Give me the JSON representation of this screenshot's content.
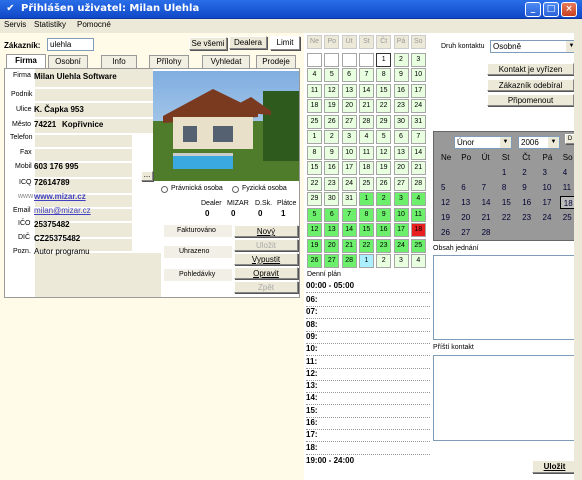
{
  "window": {
    "title": "Přihlášen uživatel: Milan Ulehla",
    "icon": "checkmark-icon"
  },
  "menu": {
    "items": [
      "Servis",
      "Statistiky",
      "Pomocné"
    ]
  },
  "customer": {
    "label": "Zákazník:",
    "value": "ulehla",
    "all_button": "Se všemi",
    "dealer_tab": "Dealera",
    "limit_tab": "Limit"
  },
  "tabs": [
    "Firma",
    "Osobní",
    "Info",
    "Přílohy",
    "Vyhledat",
    "Prodeje"
  ],
  "firm": {
    "firma_label": "Firma",
    "firma": "Milan Ulehla Software",
    "podnik_label": "Podnik",
    "ulice_label": "Ulice",
    "ulice": "K. Čapka 953",
    "mesto_label": "Město",
    "psc": "74221",
    "mesto": "Kopřivnice",
    "telefon_label": "Telefon",
    "fax_label": "Fax",
    "mobil_label": "Mobil",
    "mobil": "603 176 995",
    "icq_label": "ICQ",
    "icq": "72614789",
    "www_label": "www",
    "www": "www.mizar.cz",
    "email_label": "Email",
    "email": "milan@mizar.cz",
    "ico_label": "IČO",
    "ico": "25375482",
    "dic_label": "DIČ",
    "dic": "CZ25375482",
    "pozn_label": "Pozn.",
    "pozn": "Autor programu",
    "dots": "..."
  },
  "entity": {
    "pravnicka": "Právnická osoba",
    "fyzicka": "Fyzická osoba"
  },
  "stats": {
    "headers": [
      "Dealer",
      "MIZAR",
      "D.Sk.",
      "Plátce"
    ],
    "values": [
      "0",
      "0",
      "0",
      "1"
    ]
  },
  "billing": {
    "fakturovano": "Fakturováno",
    "uhrazeno": "Uhrazeno",
    "pohledavky": "Pohledávky"
  },
  "actions": {
    "novy": "Nový",
    "ulozit": "Uložit",
    "vypustit": "Vypustit",
    "opravit": "Opravit",
    "zpet": "Zpět"
  },
  "calendar": {
    "days": [
      "Ne",
      "Po",
      "Út",
      "St",
      "Čt",
      "Pá",
      "So"
    ],
    "rows": [
      [
        "",
        "",
        "",
        "",
        "1",
        "2",
        "3"
      ],
      [
        "4",
        "5",
        "6",
        "7",
        "8",
        "9",
        "10"
      ],
      [
        "11",
        "12",
        "13",
        "14",
        "15",
        "16",
        "17"
      ],
      [
        "18",
        "19",
        "20",
        "21",
        "22",
        "23",
        "24"
      ],
      [
        "25",
        "26",
        "27",
        "28",
        "29",
        "30",
        "31"
      ],
      [
        "1",
        "2",
        "3",
        "4",
        "5",
        "6",
        "7"
      ],
      [
        "8",
        "9",
        "10",
        "11",
        "12",
        "13",
        "14"
      ],
      [
        "15",
        "16",
        "17",
        "18",
        "19",
        "20",
        "21"
      ],
      [
        "22",
        "23",
        "24",
        "25",
        "26",
        "27",
        "28"
      ],
      [
        "29",
        "30",
        "31",
        "1",
        "2",
        "3",
        "4"
      ],
      [
        "5",
        "6",
        "7",
        "8",
        "9",
        "10",
        "11"
      ],
      [
        "12",
        "13",
        "14",
        "15",
        "16",
        "17",
        "18"
      ],
      [
        "19",
        "20",
        "21",
        "22",
        "23",
        "24",
        "25"
      ],
      [
        "26",
        "27",
        "28",
        "1",
        "2",
        "3",
        "4"
      ]
    ],
    "today": "1"
  },
  "dayplan": {
    "label": "Denní plán",
    "first": "00:00 - 05:00",
    "hours": [
      "06:",
      "07:",
      "08:",
      "09:",
      "10:",
      "11:",
      "12:",
      "13:",
      "14:",
      "15:",
      "16:",
      "17:",
      "18:"
    ],
    "last": "19:00 - 24:00"
  },
  "contact": {
    "type_label": "Druh kontaktu",
    "type_value": "Osobně",
    "btn_vyrizen": "Kontakt je vyřízen",
    "btn_odebiral": "Zákazník odebíral",
    "btn_pripomenout": "Připomenout"
  },
  "minical": {
    "month": "Únor",
    "year": "2006",
    "dbtn": "D",
    "days": [
      "Ne",
      "Po",
      "Út",
      "St",
      "Čt",
      "Pá",
      "So"
    ],
    "rows": [
      [
        "",
        "",
        "",
        "1",
        "2",
        "3",
        "4"
      ],
      [
        "5",
        "6",
        "7",
        "8",
        "9",
        "10",
        "11"
      ],
      [
        "12",
        "13",
        "14",
        "15",
        "16",
        "17",
        "18"
      ],
      [
        "19",
        "20",
        "21",
        "22",
        "23",
        "24",
        "25"
      ],
      [
        "26",
        "27",
        "28",
        "",
        "",
        "",
        ""
      ]
    ],
    "selected": "18"
  },
  "right": {
    "obsah": "Obsah jednání",
    "pristi": "Příští kontakt",
    "ulozit": "Uložit"
  },
  "colors": {
    "accent": "#1f5ad8",
    "green": "#6cf06c",
    "lightgreen": "#e8ffe0",
    "cyan": "#aaf0ff",
    "red": "#e82020",
    "minical_bg": "#999999"
  }
}
